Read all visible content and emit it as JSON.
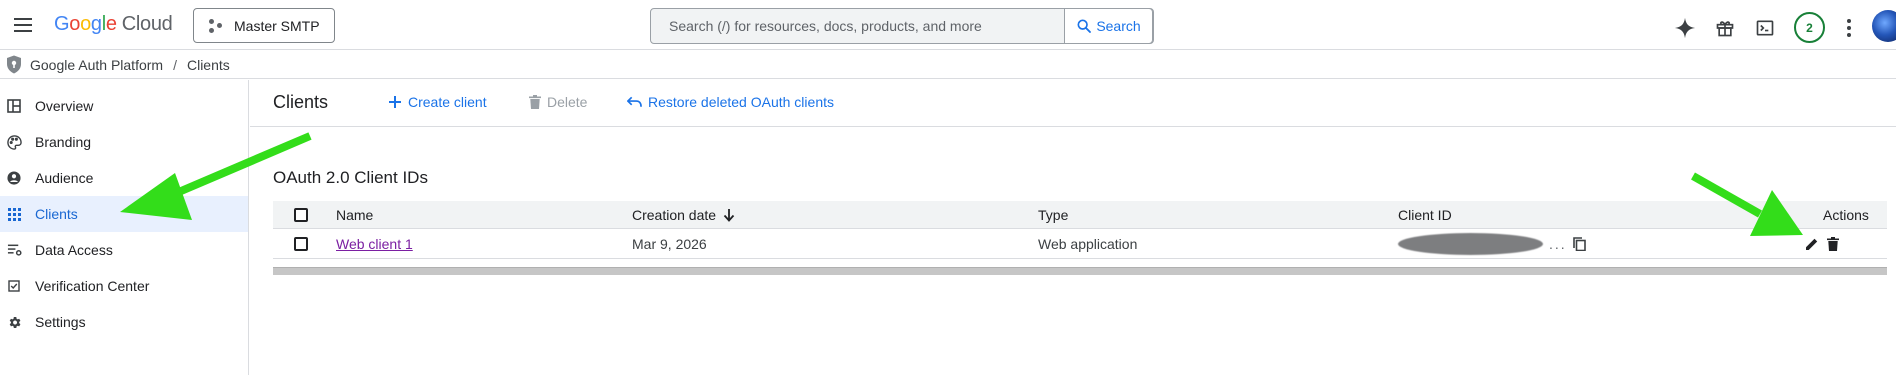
{
  "header": {
    "logo": {
      "g1": "G",
      "o1": "o",
      "o2": "o",
      "g2": "g",
      "l": "l",
      "e": "e",
      "cloud": "Cloud"
    },
    "project_name": "Master SMTP",
    "search": {
      "placeholder": "Search (/) for resources, docs, products, and more",
      "button_label": "Search"
    },
    "notification_count": "2",
    "icons": [
      "menu-icon",
      "gemini-sparkle-icon",
      "gift-icon",
      "cloud-shell-icon",
      "more-vert-icon"
    ]
  },
  "breadcrumb": {
    "root": "Google Auth Platform",
    "separator": "/",
    "current": "Clients"
  },
  "sidebar": {
    "items": [
      {
        "label": "Overview",
        "icon": "dashboard-icon"
      },
      {
        "label": "Branding",
        "icon": "palette-icon"
      },
      {
        "label": "Audience",
        "icon": "person-icon"
      },
      {
        "label": "Clients",
        "icon": "apps-icon",
        "active": true
      },
      {
        "label": "Data Access",
        "icon": "data-access-icon"
      },
      {
        "label": "Verification Center",
        "icon": "verified-icon"
      },
      {
        "label": "Settings",
        "icon": "gear-icon"
      }
    ]
  },
  "main": {
    "title": "Clients",
    "toolbar": {
      "create_label": "Create client",
      "delete_label": "Delete",
      "restore_label": "Restore deleted OAuth clients"
    },
    "section_title": "OAuth 2.0 Client IDs",
    "table": {
      "columns": [
        "Name",
        "Creation date",
        "Type",
        "Client ID",
        "Actions"
      ],
      "rows": [
        {
          "name": "Web client 1",
          "creation_date": "Mar 9, 2026",
          "type": "Web application",
          "client_id_suffix": "..."
        }
      ]
    }
  },
  "colors": {
    "accent": "#1a73e8",
    "annotation_arrow": "#33dd1a",
    "active_bg": "#e8f0fe",
    "link_visited": "#7b1fa2"
  }
}
